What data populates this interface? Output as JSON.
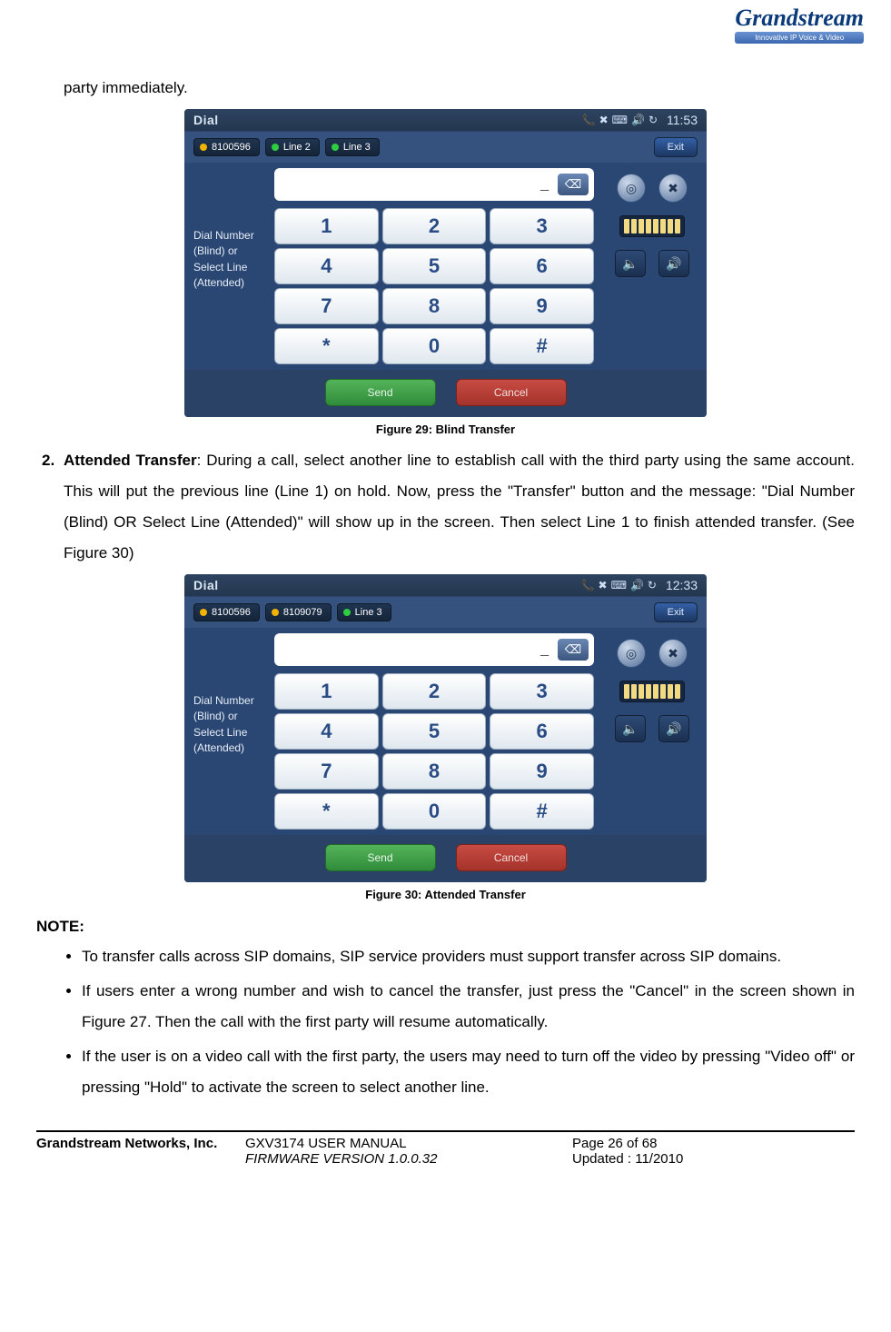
{
  "logo": {
    "brand": "Grandstream",
    "tagline": "Innovative IP Voice & Video"
  },
  "lead_text": "party immediately.",
  "caption1": "Figure 29: Blind Transfer",
  "item2_marker": "2.",
  "item2_title": "Attended Transfer",
  "item2_text": ": During a call, select another line to establish call with the third party using the same account. This will put the previous line (Line 1) on hold. Now, press the \"Transfer\" button and the message: \"Dial Number (Blind) OR Select Line (Attended)\" will show up in the screen. Then select Line 1 to finish attended transfer. (See Figure 30)",
  "caption2": "Figure 30: Attended Transfer",
  "note_head": "NOTE:",
  "notes": [
    "To transfer calls across SIP domains, SIP service providers must support transfer across SIP domains.",
    "If users enter a wrong number and wish to cancel the transfer, just press the \"Cancel\" in the screen shown in Figure 27. Then the call with the first party will resume automatically.",
    "If the user is on a video call with the first party, the users may need to turn off the video by pressing \"Video off\" or pressing \"Hold\" to activate the screen to select another line."
  ],
  "footer": {
    "company": "Grandstream Networks, Inc.",
    "doc": "GXV3174 USER MANUAL",
    "page": "Page 26 of 68",
    "fw": "FIRMWARE VERSION 1.0.0.32",
    "updated": "Updated : 11/2010"
  },
  "shot_common": {
    "title": "Dial",
    "help": "Dial Number (Blind) or Select Line (Attended)",
    "keys": [
      "1",
      "2",
      "3",
      "4",
      "5",
      "6",
      "7",
      "8",
      "9",
      "*",
      "0",
      "#"
    ],
    "backspace": "⌫",
    "cursor": "_",
    "send": "Send",
    "cancel": "Cancel",
    "exit": "Exit"
  },
  "shot1": {
    "time": "11:53",
    "tabs": [
      {
        "label": "8100596",
        "dot": "yellow"
      },
      {
        "label": "Line 2",
        "dot": "green"
      },
      {
        "label": "Line 3",
        "dot": "green"
      }
    ],
    "vol_high": true
  },
  "shot2": {
    "time": "12:33",
    "tabs": [
      {
        "label": "8100596",
        "dot": "yellow"
      },
      {
        "label": "8109079",
        "dot": "yellow"
      },
      {
        "label": "Line 3",
        "dot": "green"
      }
    ],
    "vol_high": true
  }
}
